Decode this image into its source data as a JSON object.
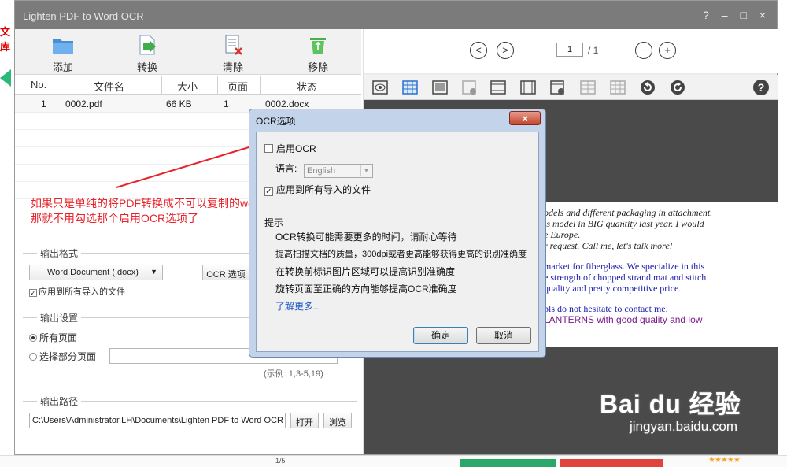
{
  "background": {
    "left_text": "文库",
    "bottom_page": "1/5",
    "stars": "★★★★★"
  },
  "window": {
    "title": "Lighten PDF to Word OCR",
    "controls": "? – □ ×"
  },
  "toolbar": {
    "add": "添加",
    "convert": "转换",
    "clear": "清除",
    "remove": "移除"
  },
  "file_list": {
    "columns": [
      "No.",
      "文件名",
      "大小",
      "页面",
      "状态"
    ],
    "rows": [
      {
        "no": "1",
        "name": "0002.pdf",
        "size": "66 KB",
        "pages": "1",
        "status": "0002.docx"
      }
    ]
  },
  "annotation": {
    "line1": "如果只是单纯的将PDF转换成不可以复制的word,",
    "line2": "那就不用勾选那个启用OCR选项了"
  },
  "output_format": {
    "heading": "输出格式",
    "format_value": "Word Document (.docx)",
    "ocr_button": "OCR 选项",
    "apply_all": "应用到所有导入的文件"
  },
  "output_settings": {
    "heading": "输出设置",
    "all_pages": "所有页面",
    "some_pages": "选择部分页面",
    "example": "(示例: 1,3-5,19)"
  },
  "output_path": {
    "heading": "输出路径",
    "path": "C:\\Users\\Administrator.LH\\Documents\\Lighten PDF to Word OCR",
    "open": "打开",
    "browse": "浏览"
  },
  "viewer": {
    "page_current": "1",
    "page_total": "/ 1",
    "doc_lines": [
      "odels and different packaging in attachment.",
      "is model in BIG quantity last year. I would",
      "e Europe.",
      "r request. Call me, let's talk more!",
      "market for fiberglass. We specialize in this",
      "e strength of chopped strand mat and stitch",
      "quality and pretty competitive price.",
      "pls do not hesitate to contact me.",
      "LANTERNS with good quality and low"
    ]
  },
  "ocr_dialog": {
    "title": "OCR选项",
    "close": "x",
    "enable_ocr": "启用OCR",
    "language_label": "语言:",
    "language_value": "English",
    "apply_all": "应用到所有导入的文件",
    "tips_heading": "提示",
    "tips": [
      "OCR转换可能需要更多的时间，请耐心等待",
      "提高扫描文档的质量，300dpi或者更高能够获得更高的识别准确度",
      "在转换前标识图片区域可以提高识别准确度",
      "旋转页面至正确的方向能够提高OCR准确度"
    ],
    "learn_more": "了解更多...",
    "ok": "确定",
    "cancel": "取消"
  },
  "watermark": {
    "brand": "Bai du 经验",
    "url": "jingyan.baidu.com"
  }
}
